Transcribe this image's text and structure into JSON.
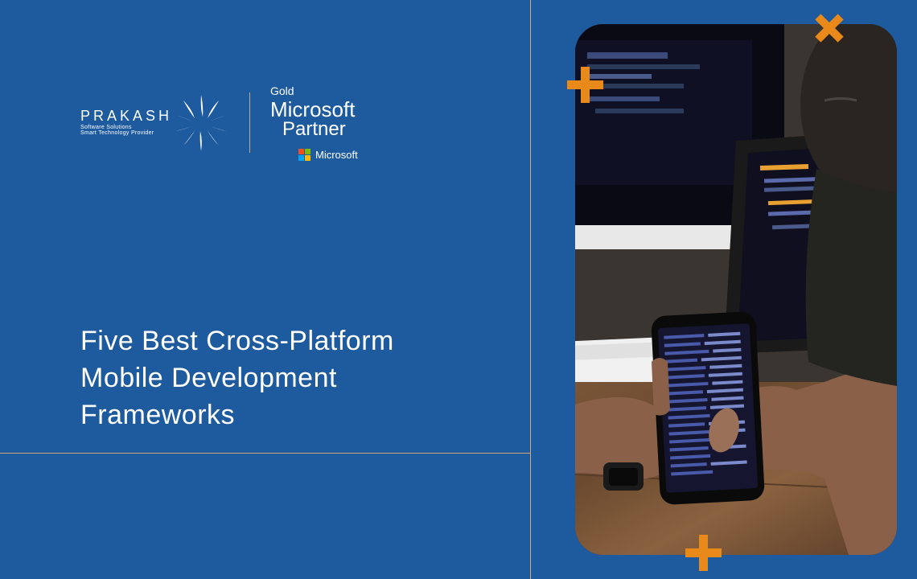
{
  "branding": {
    "company_name": "PRAKASH",
    "tagline_line1": "Software Solutions",
    "tagline_line2": "Smart Technology Provider",
    "partner": {
      "tier": "Gold",
      "brand": "Microsoft",
      "role": "Partner",
      "footer_brand": "Microsoft"
    }
  },
  "title": {
    "line1": "Five Best Cross-Platform",
    "line2": "Mobile Development",
    "line3": "Frameworks"
  },
  "colors": {
    "background": "#1e5a9e",
    "accent": "#e8891a",
    "divider": "#d4a574",
    "ms_red": "#f25022",
    "ms_green": "#7fba00",
    "ms_blue": "#00a4ef",
    "ms_yellow": "#ffb900"
  }
}
